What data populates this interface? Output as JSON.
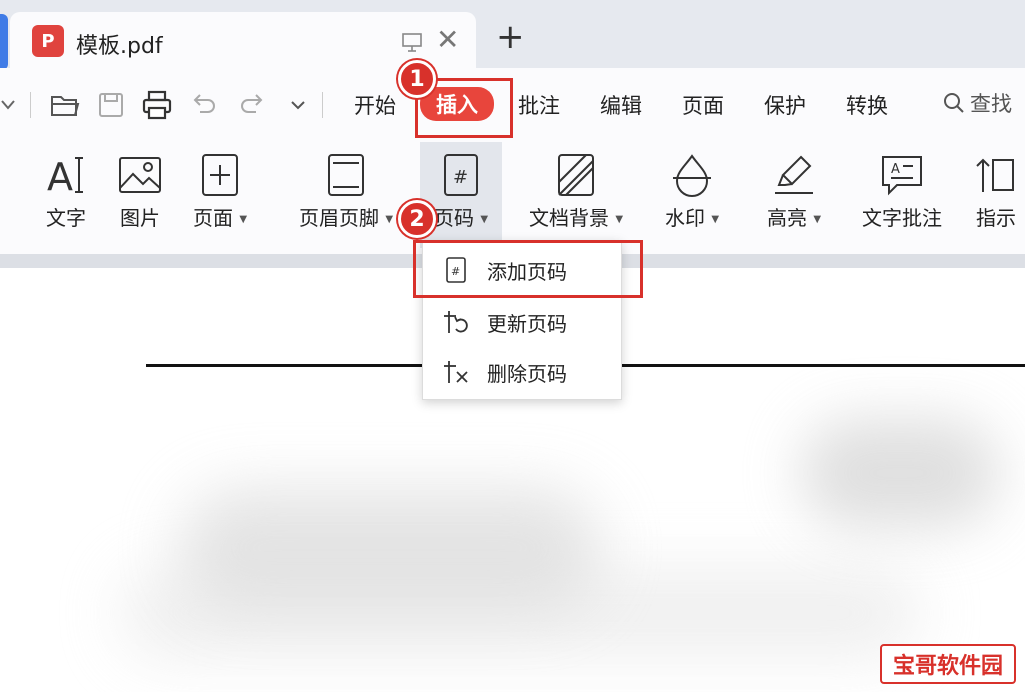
{
  "tab": {
    "title": "模板.pdf",
    "pdf_glyph": "P"
  },
  "new_tab_glyph": "+",
  "close_glyph": "✕",
  "menu": {
    "start": "开始",
    "insert": "插入",
    "comment": "批注",
    "edit": "编辑",
    "page": "页面",
    "protect": "保护",
    "convert": "转换",
    "search": "查找"
  },
  "ribbon": {
    "text": "文字",
    "image": "图片",
    "page": "页面",
    "header_footer": "页眉页脚",
    "page_number": "页码",
    "doc_background": "文档背景",
    "watermark": "水印",
    "highlight": "高亮",
    "text_comment": "文字批注",
    "indicator": "指示"
  },
  "page_number_menu": {
    "add": "添加页码",
    "update": "更新页码",
    "delete": "删除页码"
  },
  "annotations": {
    "step1": "1",
    "step2": "2"
  },
  "watermark_text": "宝哥软件园",
  "colors": {
    "accent_red": "#d8312b",
    "active_tab_red": "#e8453c",
    "tab_accent_blue": "#3f7be6"
  }
}
